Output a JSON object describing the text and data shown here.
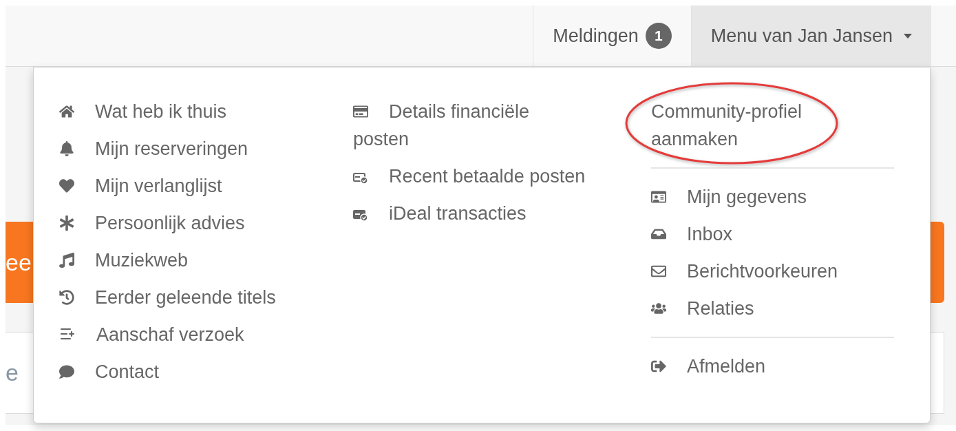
{
  "navbar": {
    "items": [
      {
        "label": "Meldingen",
        "badge": "1",
        "active": false,
        "caret": false
      },
      {
        "label": "Menu van Jan Jansen",
        "active": true,
        "caret": true
      }
    ]
  },
  "background": {
    "button_text": "ee",
    "field_text": "e"
  },
  "dropdown": {
    "columns": [
      {
        "groups": [
          [
            {
              "label": "Wat heb ik thuis"
            },
            {
              "label": "Mijn reserveringen"
            },
            {
              "label": "Mijn verlanglijst"
            },
            {
              "label": "Persoonlijk advies"
            },
            {
              "label": "Muziekweb"
            },
            {
              "label": "Eerder geleende titels"
            },
            {
              "label": "Aanschaf verzoek"
            },
            {
              "label": "Contact"
            }
          ]
        ]
      },
      {
        "groups": [
          [
            {
              "label": "Details financiële posten"
            },
            {
              "label": "Recent betaalde posten"
            },
            {
              "label": "iDeal transacties"
            }
          ]
        ]
      },
      {
        "groups": [
          [
            {
              "label": "Community-profiel aanmaken",
              "kind": "plain",
              "highlighted": true
            }
          ],
          [
            {
              "label": "Mijn gegevens",
              "kind": "icon"
            },
            {
              "label": "Inbox",
              "kind": "icon"
            },
            {
              "label": "Berichtvoorkeuren",
              "kind": "icon"
            },
            {
              "label": "Relaties",
              "kind": "icon"
            }
          ],
          [
            {
              "label": "Afmelden",
              "kind": "icon"
            }
          ]
        ]
      }
    ]
  }
}
